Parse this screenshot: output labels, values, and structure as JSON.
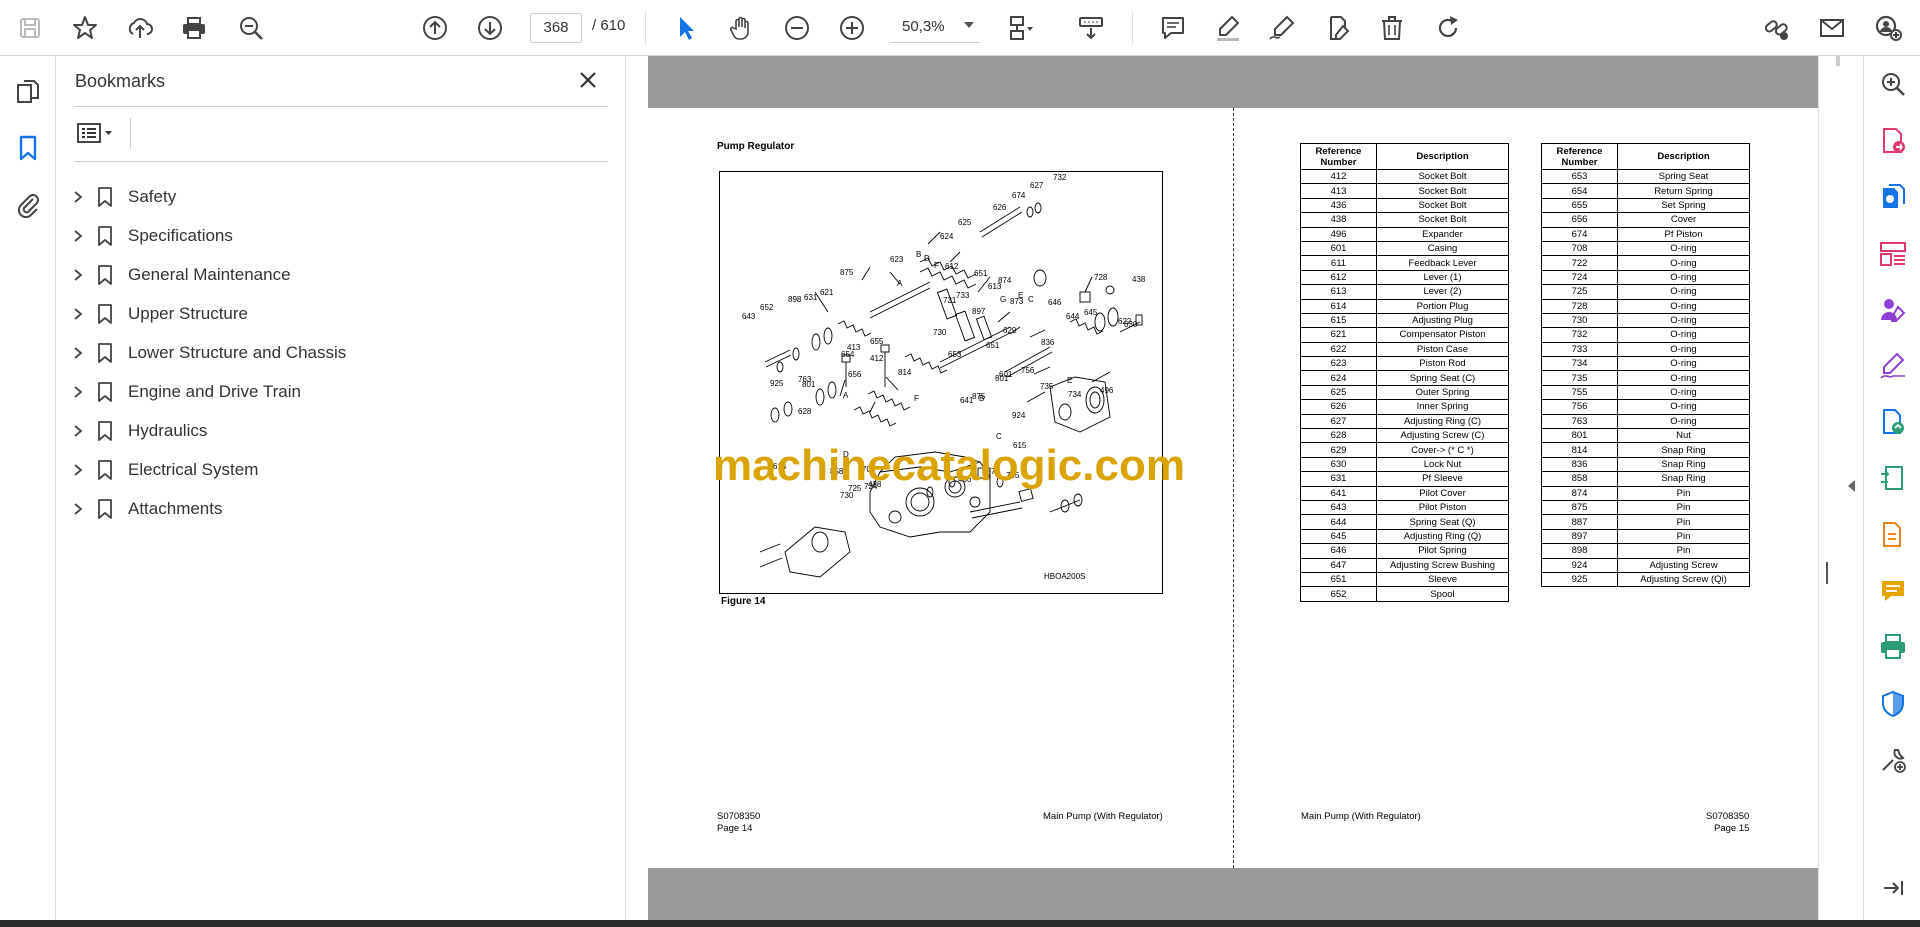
{
  "toolbar": {
    "page_current": "368",
    "page_total": "/  610",
    "zoom": "50,3%",
    "icons": [
      "save-icon",
      "star-icon",
      "upload-icon",
      "print-icon",
      "zoom-search-icon",
      "page-up-icon",
      "page-down-icon",
      "select-cursor-icon",
      "hand-icon",
      "zoom-out-icon",
      "zoom-in-icon",
      "fit-page-icon",
      "scroll-mode-icon",
      "comment-icon",
      "highlight-icon",
      "sign-icon",
      "edit-text-icon",
      "delete-icon",
      "rotate-icon",
      "share-link-icon",
      "mail-icon",
      "account-icon"
    ]
  },
  "left_rail": {
    "icons": [
      "pages-icon",
      "bookmark-icon",
      "attachment-icon"
    ]
  },
  "bookmarks_panel": {
    "title": "Bookmarks",
    "items": [
      {
        "label": "Safety"
      },
      {
        "label": "Specifications"
      },
      {
        "label": "General Maintenance"
      },
      {
        "label": "Upper Structure"
      },
      {
        "label": "Lower Structure and Chassis"
      },
      {
        "label": "Engine and Drive Train"
      },
      {
        "label": "Hydraulics"
      },
      {
        "label": "Electrical System"
      },
      {
        "label": "Attachments"
      }
    ]
  },
  "document": {
    "left_page": {
      "heading": "Pump Regulator",
      "figure_caption": "Figure 14",
      "figure_code": "HBOA200S",
      "footer_left": "S0708350",
      "footer_left2": "Page 14",
      "footer_right": "Main Pump (With Regulator)",
      "callouts": [
        "732",
        "627",
        "674",
        "626",
        "625",
        "624",
        "D",
        "B",
        "623",
        "F",
        "612",
        "651",
        "874",
        "613",
        "E",
        "897",
        "G",
        "873",
        "C",
        "646",
        "644",
        "645",
        "728",
        "438",
        "630",
        "622",
        "621",
        "875",
        "A",
        "733",
        "731",
        "631",
        "898",
        "652",
        "643",
        "730",
        "629",
        "651",
        "836",
        "655",
        "412",
        "413",
        "654",
        "653",
        "814",
        "656",
        "763",
        "925",
        "801",
        "628",
        "924",
        "801",
        "601",
        "756",
        "735",
        "E",
        "496",
        "734",
        "875",
        "F",
        "641",
        "B",
        "A",
        "C",
        "D",
        "615",
        "887",
        "755",
        "614",
        "858",
        "708",
        "725",
        "730",
        "724",
        "438",
        "436"
      ]
    },
    "right_page": {
      "footer_left": "Main Pump (With Regulator)",
      "footer_right": "S0708350",
      "footer_right2": "Page 15",
      "table_headers": {
        "ref": "Reference Number",
        "desc": "Description"
      },
      "table1": [
        [
          "412",
          "Socket Bolt"
        ],
        [
          "413",
          "Socket Bolt"
        ],
        [
          "436",
          "Socket Bolt"
        ],
        [
          "438",
          "Socket Bolt"
        ],
        [
          "496",
          "Expander"
        ],
        [
          "601",
          "Casing"
        ],
        [
          "611",
          "Feedback Lever"
        ],
        [
          "612",
          "Lever (1)"
        ],
        [
          "613",
          "Lever (2)"
        ],
        [
          "614",
          "Portion Plug"
        ],
        [
          "615",
          "Adjusting Plug"
        ],
        [
          "621",
          "Compensator Piston"
        ],
        [
          "622",
          "Piston Case"
        ],
        [
          "623",
          "Piston Rod"
        ],
        [
          "624",
          "Spring Seat (C)"
        ],
        [
          "625",
          "Outer Spring"
        ],
        [
          "626",
          "Inner Spring"
        ],
        [
          "627",
          "Adjusting Ring (C)"
        ],
        [
          "628",
          "Adjusting Screw (C)"
        ],
        [
          "629",
          "Cover-> (* C *)"
        ],
        [
          "630",
          "Lock Nut"
        ],
        [
          "631",
          "Pf Sleeve"
        ],
        [
          "641",
          "Pilot Cover"
        ],
        [
          "643",
          "Pilot Piston"
        ],
        [
          "644",
          "Spring Seat (Q)"
        ],
        [
          "645",
          "Adjusting Ring (Q)"
        ],
        [
          "646",
          "Pilot Spring"
        ],
        [
          "647",
          "Adjusting Screw Bushing"
        ],
        [
          "651",
          "Sleeve"
        ],
        [
          "652",
          "Spool"
        ]
      ],
      "table2": [
        [
          "653",
          "Spring Seat"
        ],
        [
          "654",
          "Return Spring"
        ],
        [
          "655",
          "Set Spring"
        ],
        [
          "656",
          "Cover"
        ],
        [
          "674",
          "Pf Piston"
        ],
        [
          "708",
          "O-ring"
        ],
        [
          "722",
          "O-ring"
        ],
        [
          "724",
          "O-ring"
        ],
        [
          "725",
          "O-ring"
        ],
        [
          "728",
          "O-ring"
        ],
        [
          "730",
          "O-ring"
        ],
        [
          "732",
          "O-ring"
        ],
        [
          "733",
          "O-ring"
        ],
        [
          "734",
          "O-ring"
        ],
        [
          "735",
          "O-ring"
        ],
        [
          "755",
          "O-ring"
        ],
        [
          "756",
          "O-ring"
        ],
        [
          "763",
          "O-ring"
        ],
        [
          "801",
          "Nut"
        ],
        [
          "814",
          "Snap Ring"
        ],
        [
          "836",
          "Snap Ring"
        ],
        [
          "858",
          "Snap Ring"
        ],
        [
          "874",
          "Pin"
        ],
        [
          "875",
          "Pin"
        ],
        [
          "887",
          "Pin"
        ],
        [
          "897",
          "Pin"
        ],
        [
          "898",
          "Pin"
        ],
        [
          "924",
          "Adjusting Screw"
        ],
        [
          "925",
          "Adjusting Screw (Qi)"
        ]
      ]
    },
    "watermark": "machinecatalogic.com"
  },
  "right_rail": {
    "icons": [
      "zoom-search-icon",
      "export-pdf-icon",
      "create-pdf-icon",
      "organize-pages-icon",
      "fill-sign-icon",
      "request-signature-icon",
      "combine-files-icon",
      "compress-icon",
      "edit-pdf-icon",
      "comment-icon",
      "print-production-icon",
      "protect-icon",
      "more-tools-icon",
      "expand-icon"
    ]
  },
  "colors": {
    "accent": "#1473e6",
    "pink": "#e3386b",
    "purple": "#8f3fd6",
    "green": "#2d9d78",
    "orange": "#e68619",
    "grey_bg": "#9b9b9b",
    "watermark": "#d9a400"
  }
}
